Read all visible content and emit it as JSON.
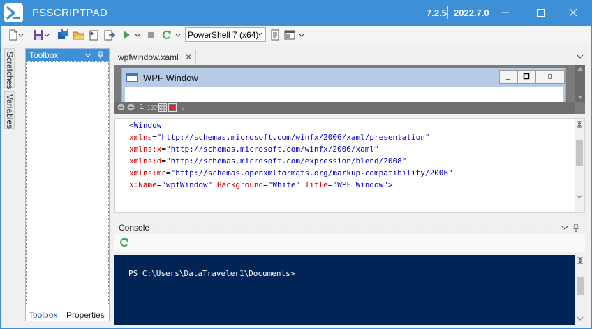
{
  "titlebar": {
    "app_title": "PSSCRIPTPAD",
    "version": "7.2.5",
    "build": "2022.7.0",
    "brand_color": "#3d8fd6"
  },
  "toolbar": {
    "powershell_version": "PowerShell 7 (x64)"
  },
  "left_rail": {
    "tabs": [
      "Scratches",
      "Variables"
    ]
  },
  "toolbox": {
    "title": "Toolbox",
    "bottom_tabs": [
      "Toolbox",
      "Properties"
    ]
  },
  "editor": {
    "tab_label": "wpfwindow.xaml",
    "designer": {
      "window_title": "WPF Window",
      "zoom_value": "1",
      "zoom_percent": "100%"
    },
    "code_lines": [
      {
        "tag": "<Window",
        "attr": "",
        "eq": "",
        "val": ""
      },
      {
        "tag": "",
        "attr": "xmlns",
        "eq": "=",
        "val": "\"http://schemas.microsoft.com/winfx/2006/xaml/presentation\""
      },
      {
        "tag": "",
        "attr": "xmlns:x",
        "eq": "=",
        "val": "\"http://schemas.microsoft.com/winfx/2006/xaml\""
      },
      {
        "tag": "",
        "attr": "xmlns:d",
        "eq": "=",
        "val": "\"http://schemas.microsoft.com/expression/blend/2008\""
      },
      {
        "tag": "",
        "attr": "xmlns:mc",
        "eq": "=",
        "val": "\"http://schemas.openxmlformats.org/markup-compatibility/2006\""
      }
    ],
    "last_line": {
      "a1": "x:Name",
      "v1": "\"wpfWindow\"",
      "a2": "Background",
      "v2": "\"White\"",
      "a3": "Title",
      "v3": "\"WPF Window\"",
      "close": ">"
    }
  },
  "console": {
    "title": "Console",
    "prompt": "PS C:\\Users\\DataTraveler1\\Documents>",
    "bg_color": "#012456"
  }
}
